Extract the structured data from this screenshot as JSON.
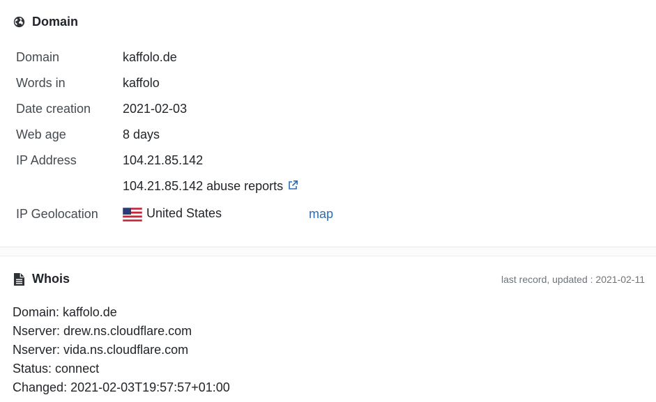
{
  "domain_section": {
    "title": "Domain",
    "rows": {
      "domain": {
        "label": "Domain",
        "value": "kaffolo.de"
      },
      "words": {
        "label": "Words in",
        "value": "kaffolo"
      },
      "date_creation": {
        "label": "Date creation",
        "value": "2021-02-03"
      },
      "web_age": {
        "label": "Web age",
        "value": "8 days"
      },
      "ip_address": {
        "label": "IP Address",
        "value": "104.21.85.142"
      },
      "abuse": {
        "value": "104.21.85.142 abuse reports"
      },
      "geolocation": {
        "label": "IP Geolocation",
        "value": "United States",
        "map_label": "map"
      }
    }
  },
  "whois_section": {
    "title": "Whois",
    "updated": "last record, updated : 2021-02-11",
    "lines": [
      "Domain: kaffolo.de",
      "Nserver: drew.ns.cloudflare.com",
      "Nserver: vida.ns.cloudflare.com",
      "Status: connect",
      "Changed: 2021-02-03T19:57:57+01:00"
    ]
  },
  "colors": {
    "link": "#2c6db5",
    "text": "#212529",
    "muted": "#6c737a"
  },
  "icons": {
    "domain": "globe-icon",
    "whois": "document-icon",
    "abuse": "external-link-icon",
    "flag": "us-flag-icon"
  }
}
